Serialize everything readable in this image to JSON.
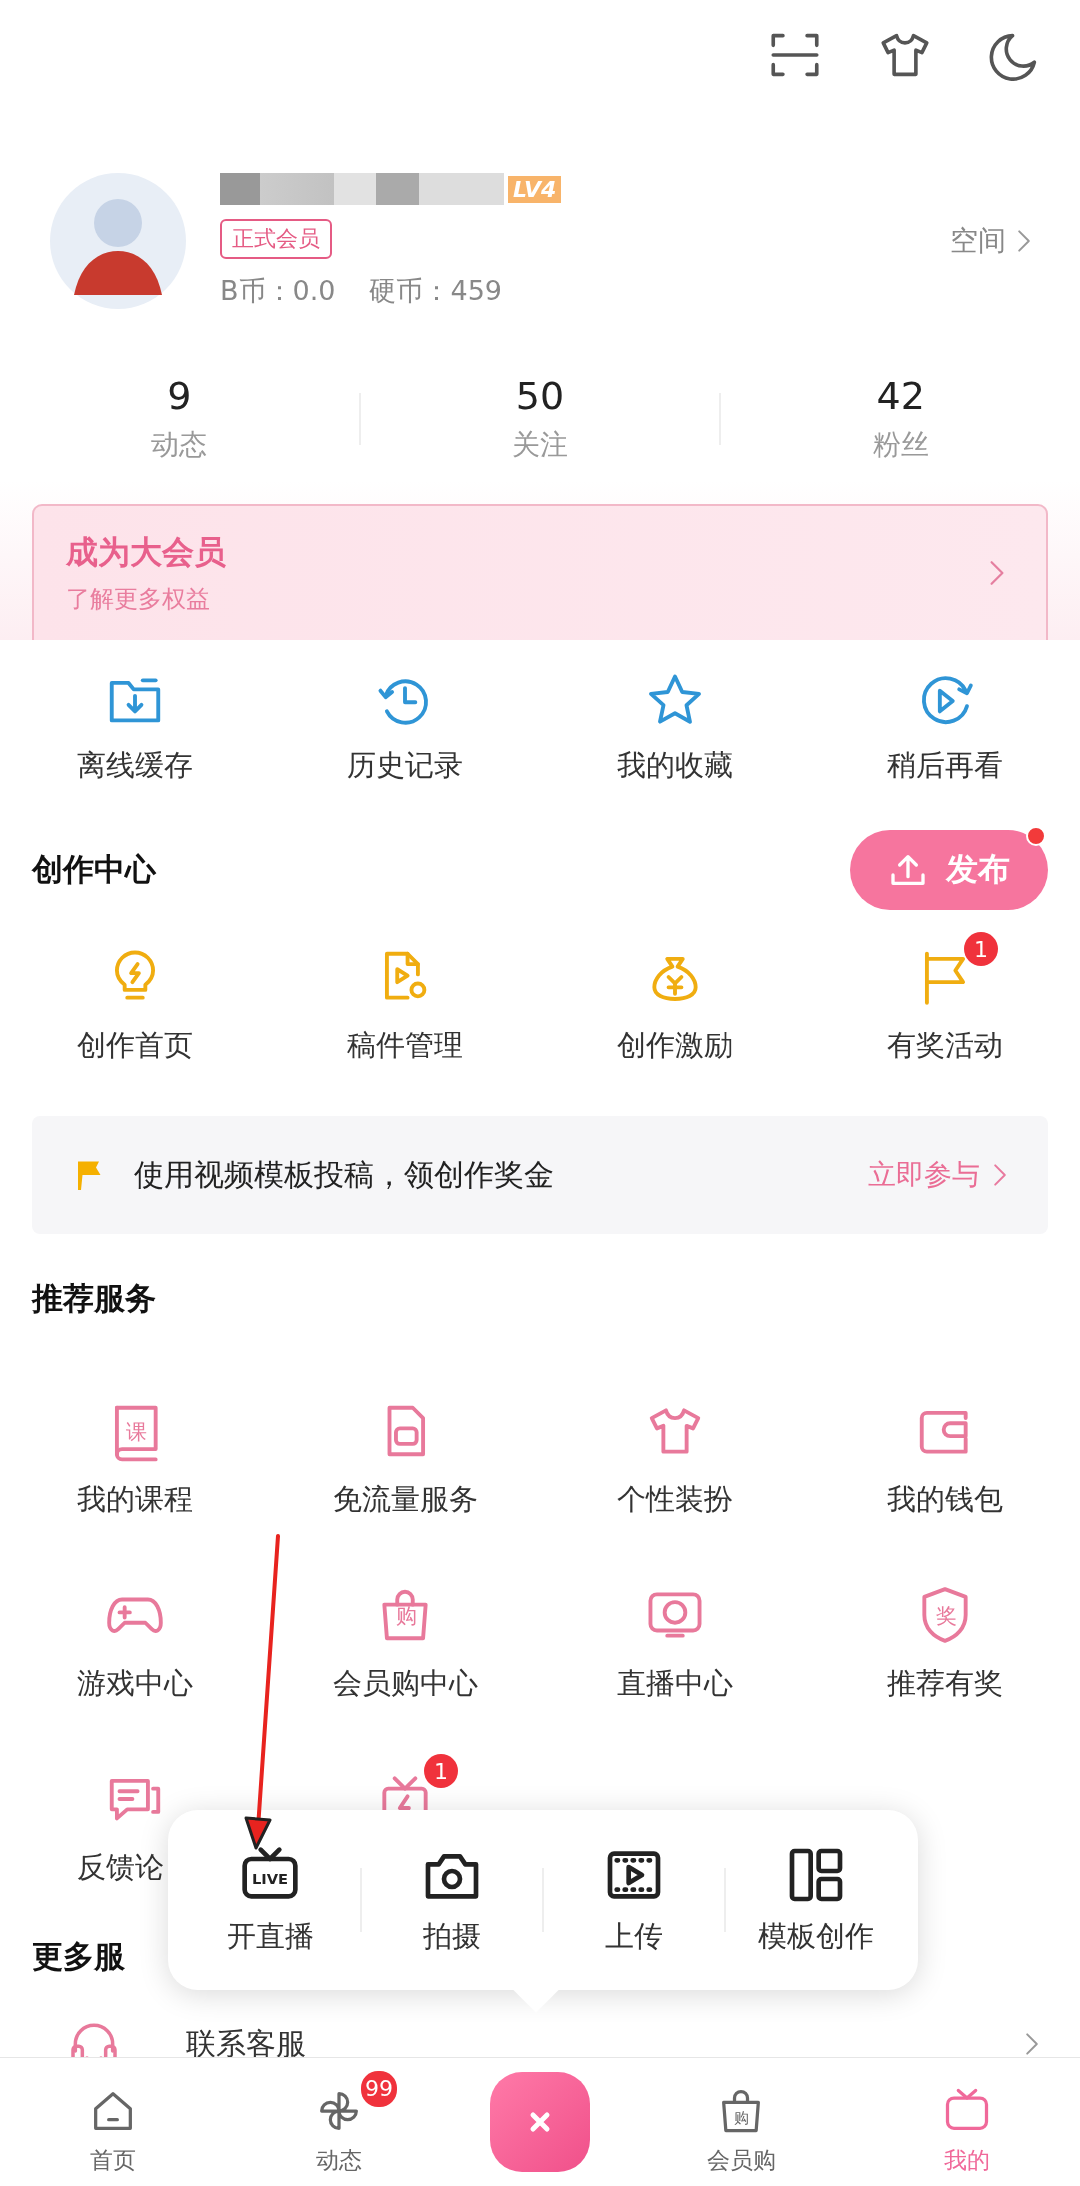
{
  "profile": {
    "level_badge": "LV4",
    "membership_tag": "正式会员",
    "b_coins": "B币：0.0",
    "coins": "硬币：459",
    "space_link": "空间"
  },
  "stats": [
    {
      "value": "9",
      "label": "动态"
    },
    {
      "value": "50",
      "label": "关注"
    },
    {
      "value": "42",
      "label": "粉丝"
    }
  ],
  "vip_card": {
    "title": "成为大会员",
    "subtitle": "了解更多权益"
  },
  "quick_actions": [
    {
      "label": "离线缓存"
    },
    {
      "label": "历史记录"
    },
    {
      "label": "我的收藏"
    },
    {
      "label": "稍后再看"
    }
  ],
  "creation_center": {
    "title": "创作中心",
    "publish_button": {
      "label": "发布",
      "dot": true
    },
    "items": [
      {
        "label": "创作首页"
      },
      {
        "label": "稿件管理"
      },
      {
        "label": "创作激励"
      },
      {
        "label": "有奖活动",
        "badge": "1"
      }
    ],
    "banner": {
      "text": "使用视频模板投稿，领创作奖金",
      "action": "立即参与"
    }
  },
  "recommended_services": {
    "title": "推荐服务",
    "items": [
      {
        "label": "我的课程",
        "icon_text": "课"
      },
      {
        "label": "免流量服务"
      },
      {
        "label": "个性装扮"
      },
      {
        "label": "我的钱包"
      },
      {
        "label": "游戏中心"
      },
      {
        "label": "会员购中心",
        "icon_text": "购"
      },
      {
        "label": "直播中心"
      },
      {
        "label": "推荐有奖",
        "icon_text": "奖"
      },
      {
        "label": "反馈论"
      },
      {
        "badge": "1"
      }
    ]
  },
  "more_services": {
    "title": "更多服",
    "items": [
      {
        "label": "联系客服"
      }
    ]
  },
  "publish_menu": {
    "items": [
      {
        "label": "开直播",
        "icon_text": "LIVE"
      },
      {
        "label": "拍摄"
      },
      {
        "label": "上传"
      },
      {
        "label": "模板创作"
      }
    ]
  },
  "bottom_nav": [
    {
      "kind": "tab",
      "label": "首页",
      "selected": false
    },
    {
      "kind": "tab",
      "label": "动态",
      "badge": "99",
      "selected": false
    },
    {
      "kind": "action"
    },
    {
      "kind": "tab",
      "label": "会员购",
      "icon_text": "购",
      "selected": false
    },
    {
      "kind": "tab",
      "label": "我的",
      "selected": true
    }
  ]
}
